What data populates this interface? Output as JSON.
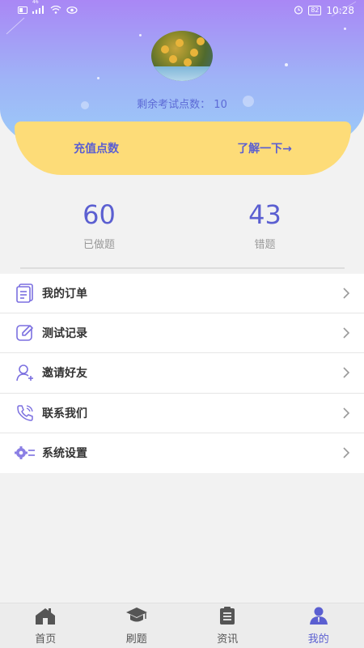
{
  "status_bar": {
    "signal_badge": "46",
    "battery": "82",
    "time": "10:28"
  },
  "profile": {
    "points_label": "剩余考试点数：",
    "points_value": "10"
  },
  "card": {
    "recharge_label": "充值点数",
    "learn_more_label": "了解一下→"
  },
  "stats": [
    {
      "value": "60",
      "label": "已做题"
    },
    {
      "value": "43",
      "label": "错题"
    }
  ],
  "menu": {
    "items": [
      {
        "label": "我的订单",
        "icon": "order-list-icon"
      },
      {
        "label": "测试记录",
        "icon": "edit-record-icon"
      },
      {
        "label": "邀请好友",
        "icon": "add-user-icon"
      },
      {
        "label": "联系我们",
        "icon": "phone-icon"
      },
      {
        "label": "系统设置",
        "icon": "settings-gear-icon"
      }
    ]
  },
  "tabs": [
    {
      "label": "首页",
      "icon": "home-icon"
    },
    {
      "label": "刷题",
      "icon": "graduation-cap-icon"
    },
    {
      "label": "资讯",
      "icon": "clipboard-icon"
    },
    {
      "label": "我的",
      "icon": "user-icon",
      "active": true
    }
  ],
  "colors": {
    "accent": "#5b5fd1",
    "card": "#fddc78",
    "icon": "#7b6fe0"
  }
}
